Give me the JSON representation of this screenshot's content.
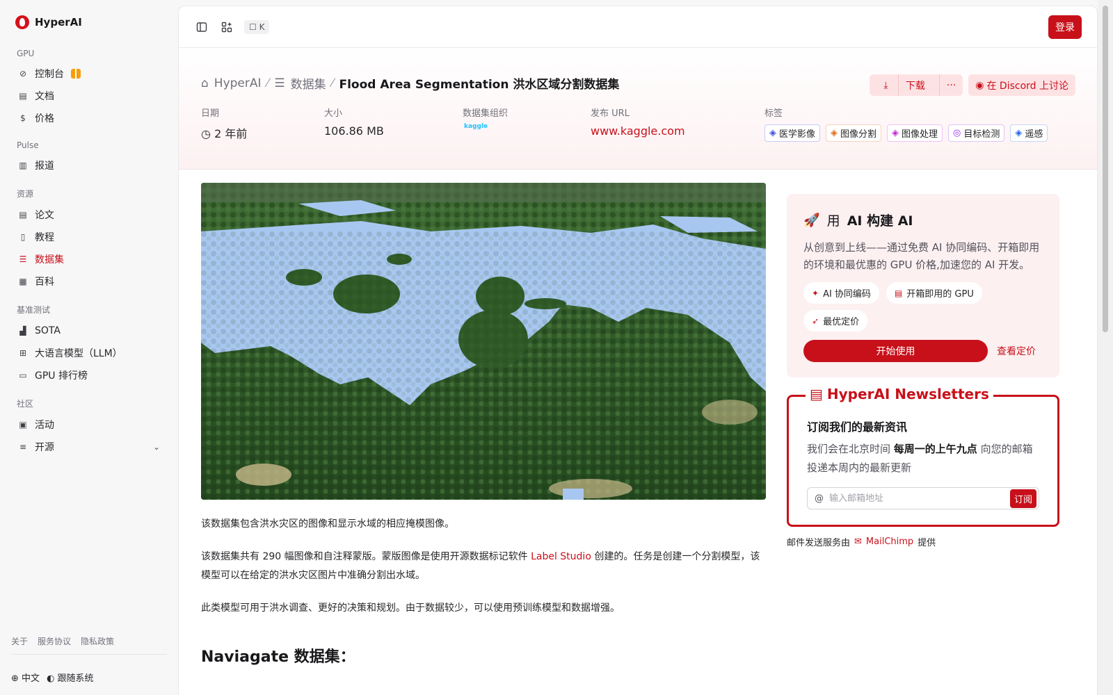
{
  "brand": {
    "name": "HyperAI"
  },
  "sidebar": {
    "sections": [
      {
        "title": "GPU",
        "items": [
          {
            "label": "控制台"
          },
          {
            "label": "文档"
          },
          {
            "label": "价格"
          }
        ]
      },
      {
        "title": "Pulse",
        "items": [
          {
            "label": "报道"
          }
        ]
      },
      {
        "title": "资源",
        "items": [
          {
            "label": "论文"
          },
          {
            "label": "教程"
          },
          {
            "label": "数据集"
          },
          {
            "label": "百科"
          }
        ]
      },
      {
        "title": "基准测试",
        "items": [
          {
            "label": "SOTA"
          },
          {
            "label": "大语言模型（LLM）"
          },
          {
            "label": "GPU 排行榜"
          }
        ]
      },
      {
        "title": "社区",
        "items": [
          {
            "label": "活动"
          },
          {
            "label": "开源"
          }
        ]
      }
    ],
    "footer_links": [
      "关于",
      "服务协议",
      "隐私政策"
    ],
    "language": "中文",
    "theme": "跟随系统"
  },
  "topbar": {
    "kbd": "K",
    "login_label": "登录"
  },
  "breadcrumb": {
    "home": "HyperAI",
    "section": "数据集",
    "current": "Flood Area Segmentation 洪水区域分割数据集"
  },
  "actions": {
    "download_label": "下载",
    "more_label": "···",
    "discord_label": "在 Discord 上讨论"
  },
  "meta": {
    "date_label": "日期",
    "date_value": "2 年前",
    "size_label": "大小",
    "size_value": "106.86 MB",
    "org_label": "数据集组织",
    "org_logo": "kaggle",
    "url_label": "发布 URL",
    "url_value": "www.kaggle.com",
    "tags_label": "标签",
    "tags": [
      {
        "label": "医学影像",
        "color": "#3b4fd9"
      },
      {
        "label": "图像分割",
        "color": "#e26a1b"
      },
      {
        "label": "图像处理",
        "color": "#c026d3"
      },
      {
        "label": "目标检测",
        "color": "#9333ea"
      },
      {
        "label": "遥感",
        "color": "#2563eb"
      }
    ]
  },
  "content": {
    "p1": "该数据集包含洪水灾区的图像和显示水域的相应掩模图像。",
    "p2_before": "该数据集共有 290 幅图像和自注释蒙版。蒙版图像是使用开源数据标记软件 ",
    "p2_link": "Label Studio",
    "p2_after": " 创建的。任务是创建一个分割模型，该模型可以在给定的洪水灾区图片中准确分割出水域。",
    "p3": "此类模型可用于洪水调查、更好的决策和规划。由于数据较少，可以使用预训练模型和数据增强。",
    "h2": "Naviagate 数据集："
  },
  "ai_card": {
    "title_prefix": "用",
    "title_bold": "AI 构建 AI",
    "desc": "从创意到上线——通过免费 AI 协同编码、开箱即用的环境和最优惠的 GPU 价格,加速您的 AI 开发。",
    "features": [
      "AI 协同编码",
      "开箱即用的 GPU",
      "最优定价"
    ],
    "start_label": "开始使用",
    "pricing_label": "查看定价"
  },
  "newsletter": {
    "legend": "HyperAI Newsletters",
    "title": "订阅我们的最新资讯",
    "desc_before": "我们会在北京时间 ",
    "desc_bold": "每周一的上午九点",
    "desc_after": " 向您的邮箱投递本周内的最新更新",
    "placeholder": "输入邮箱地址",
    "subscribe_label": "订阅",
    "provider_before": "邮件发送服务由",
    "provider_name": "MailChimp",
    "provider_after": "提供"
  },
  "colors": {
    "accent": "#c8101a",
    "water": "#a8c7f0",
    "forest": "#2f5a27"
  }
}
